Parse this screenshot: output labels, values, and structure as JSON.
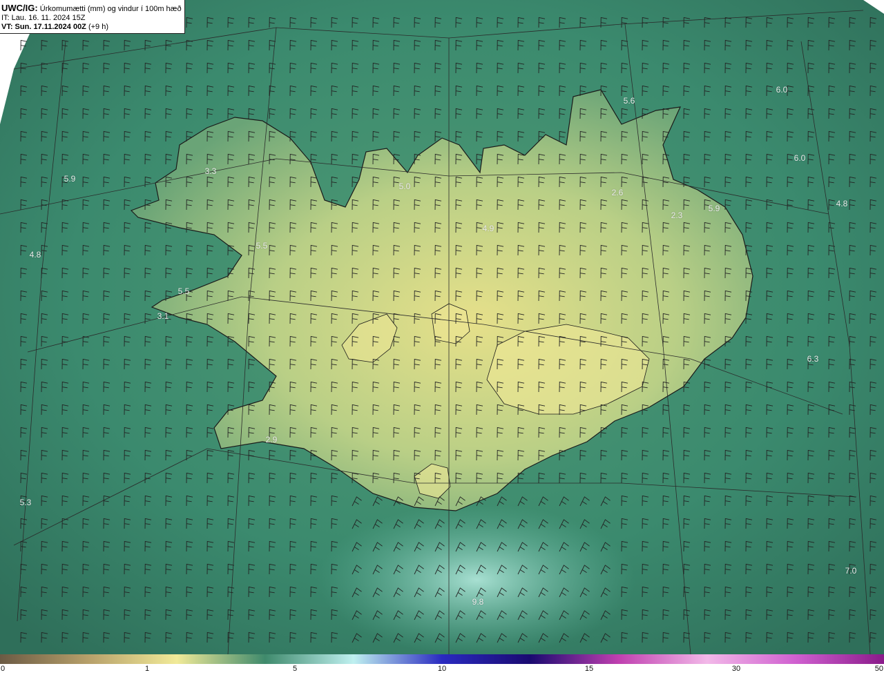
{
  "header": {
    "model": "UWC/IG:",
    "title": "Úrkomumætti (mm) og vindur í 100m hæð",
    "init_time": "IT: Lau. 16. 11. 2024 15Z",
    "valid_prefix": "VT: Sun. 17.11.2024 00Z",
    "valid_suffix": "(+9 h)"
  },
  "colors": {
    "ocean_dark": "#2f6f5a",
    "ocean_mid": "#3b8a6e",
    "land_low": "#5e9e74",
    "land_high": "#e6e08a",
    "coast": "#1a1a1a",
    "grid": "#2a2a2a",
    "barb": "#222222",
    "label": "#e8e8e8"
  },
  "labels": [
    {
      "text": "5.6"
    },
    {
      "text": "6.0"
    },
    {
      "text": "6.0"
    },
    {
      "text": "5.9"
    },
    {
      "text": "3.3"
    },
    {
      "text": "5.0"
    },
    {
      "text": "2.6"
    },
    {
      "text": "2.3"
    },
    {
      "text": "5.9"
    },
    {
      "text": "4.8"
    },
    {
      "text": "4.9"
    },
    {
      "text": "5.5"
    },
    {
      "text": "4.8"
    },
    {
      "text": "5.5"
    },
    {
      "text": "3.1"
    },
    {
      "text": "6.3"
    },
    {
      "text": "2.9"
    },
    {
      "text": "5.3"
    },
    {
      "text": "7.0"
    },
    {
      "text": "9.8"
    }
  ],
  "colorbar": {
    "ticks": [
      "0",
      "1",
      "5",
      "10",
      "15",
      "30",
      "50"
    ],
    "stops": [
      "#6b5a44",
      "#b7a06a",
      "#f1ea98",
      "#3f8a6c",
      "#bff0f0",
      "#2a2ac0",
      "#1a0a70",
      "#c040b0",
      "#f2b8e8",
      "#d060d0",
      "#8a1a8a"
    ]
  }
}
